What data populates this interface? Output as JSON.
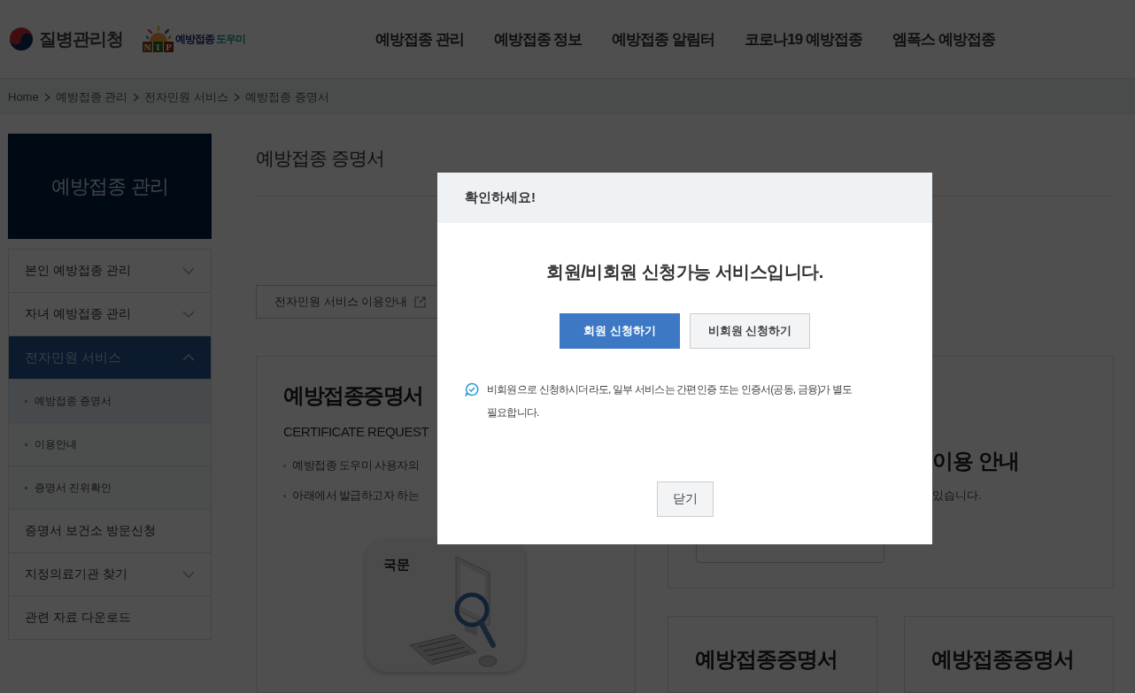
{
  "header": {
    "agency": "질병관리청",
    "service_logo": {
      "blocks": [
        "N",
        "I",
        "P"
      ],
      "name_1": "예방접종",
      "name_2": "도우미"
    },
    "nav": [
      "예방접종 관리",
      "예방접종 정보",
      "예방접종 알림터",
      "코로나19 예방접종",
      "엠폭스 예방접종"
    ]
  },
  "breadcrumb": [
    "Home",
    "예방접종 관리",
    "전자민원 서비스",
    "예방접종 증명서"
  ],
  "sidebar": {
    "title": "예방접종 관리",
    "items": [
      {
        "label": "본인 예방접종 관리",
        "kind": "group",
        "expanded": false,
        "selected": false
      },
      {
        "label": "자녀 예방접종 관리",
        "kind": "group",
        "expanded": false,
        "selected": false
      },
      {
        "label": "전자민원 서비스",
        "kind": "group",
        "expanded": true,
        "selected": true,
        "children": [
          {
            "label": "예방접종 증명서",
            "selected": true
          },
          {
            "label": "이용안내",
            "selected": false
          },
          {
            "label": "증명서 진위확인",
            "selected": false
          }
        ]
      },
      {
        "label": "증명서 보건소 방문신청",
        "kind": "link",
        "selected": false
      },
      {
        "label": "지정의료기관 찾기",
        "kind": "group",
        "expanded": false,
        "selected": false
      },
      {
        "label": "관련 자료 다운로드",
        "kind": "link",
        "selected": false
      }
    ]
  },
  "content": {
    "title": "예방접종 증명서",
    "guide_button": "전자민원 서비스 이용안내",
    "request_card": {
      "title": "예방접종증명서",
      "subtitle": "CERTIFICATE REQUEST",
      "bullets": [
        "예방접종 도우미 사용자의",
        "아래에서 발급하고자 하는"
      ],
      "tile_label": "국문"
    },
    "guide_card": {
      "title": "이용 안내",
      "text": "있습니다."
    },
    "small_cards": [
      "예방접종증명서",
      "예방접종증명서"
    ]
  },
  "dialog": {
    "title": "확인하세요!",
    "heading": "회원/비회원 신청가능 서비스입니다.",
    "buttons": [
      {
        "label": "회원 신청하기",
        "primary": true
      },
      {
        "label": "비회원 신청하기",
        "primary": false
      }
    ],
    "note": "비회원으로 신청하시더라도, 일부 서비스는 간편인증 또는 인증서(공동, 금융)가 별도 필요합니다.",
    "close": "닫기"
  }
}
